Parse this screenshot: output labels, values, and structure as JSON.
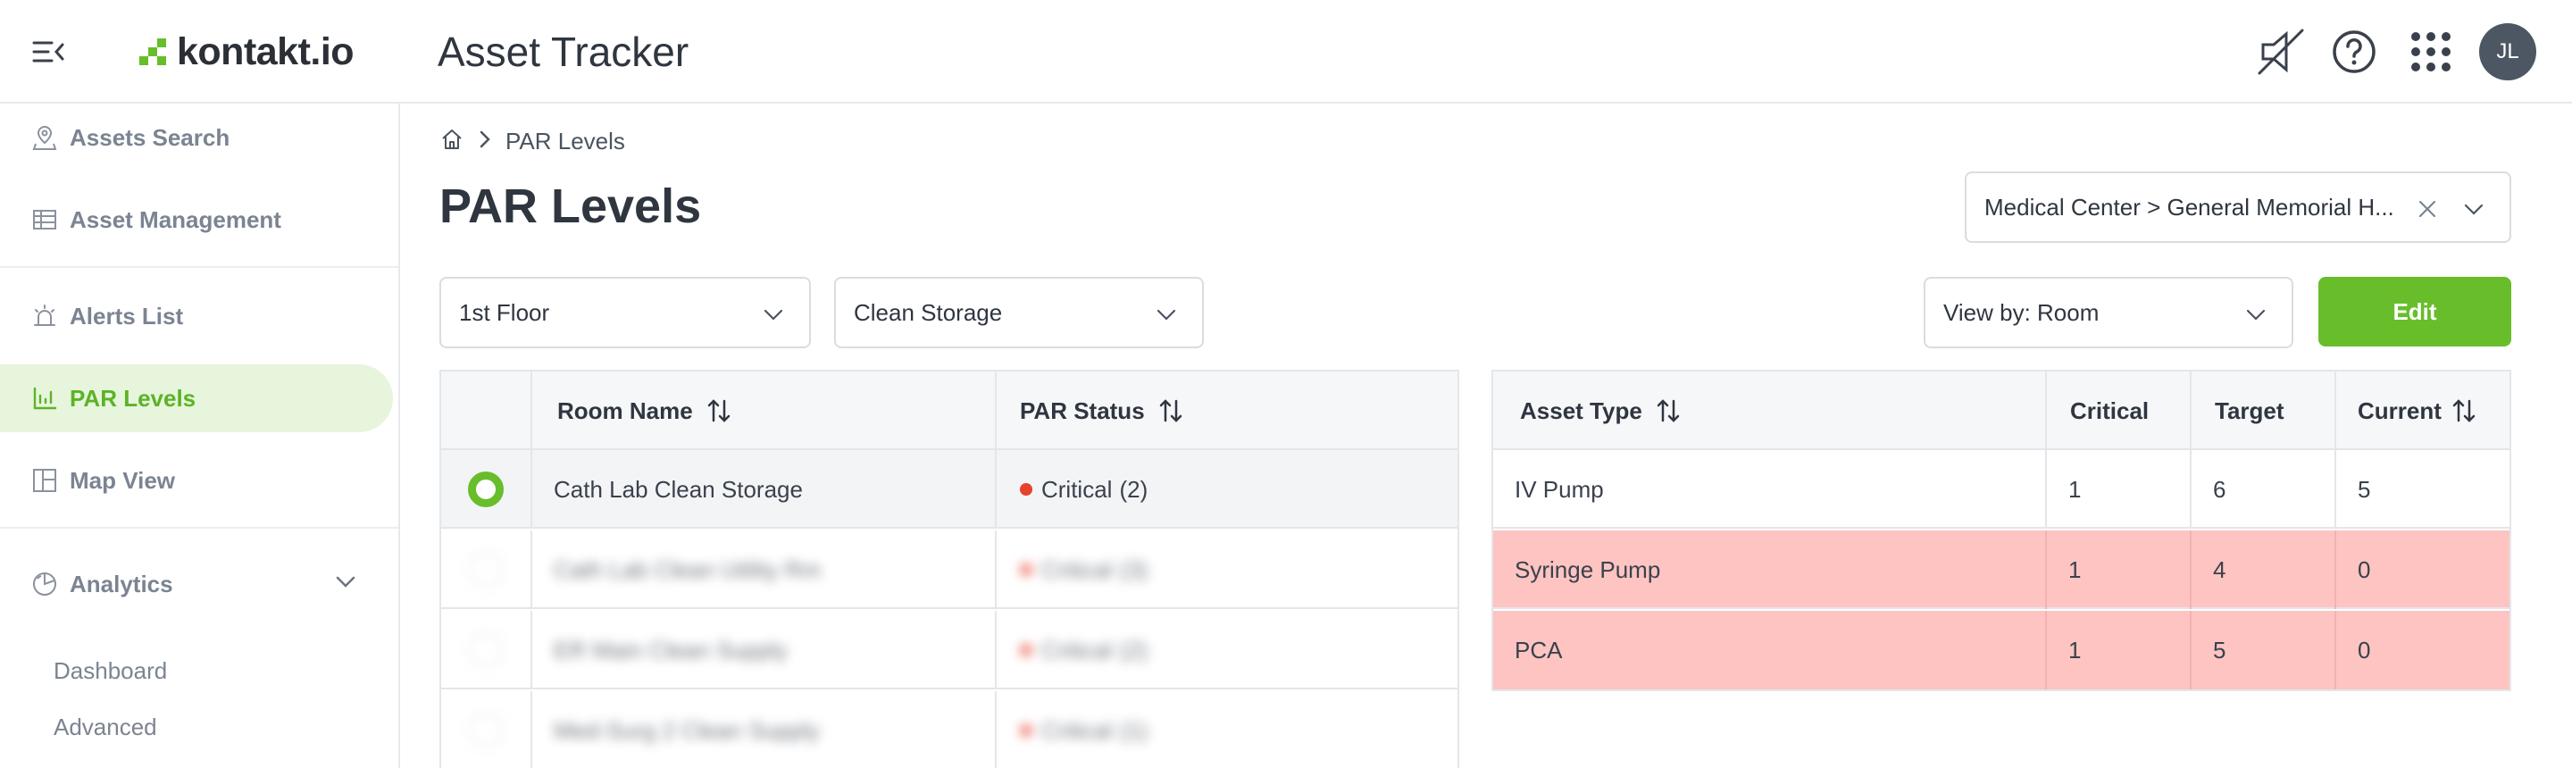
{
  "header": {
    "logo_text": "kontakt.io",
    "app_title": "Asset Tracker",
    "user_initials": "JL",
    "brand_color": "#68bd2b"
  },
  "sidebar": {
    "items": [
      {
        "label": "Assets Search",
        "icon": "map-pin-icon"
      },
      {
        "label": "Asset Management",
        "icon": "table-icon"
      },
      {
        "label": "Alerts List",
        "icon": "alarm-icon"
      },
      {
        "label": "PAR Levels",
        "icon": "bar-chart-icon",
        "active": true
      },
      {
        "label": "Map View",
        "icon": "layout-icon"
      },
      {
        "label": "Analytics",
        "icon": "analytics-icon",
        "expanded": true
      }
    ],
    "sub_items": [
      {
        "label": "Dashboard"
      },
      {
        "label": "Advanced"
      }
    ]
  },
  "breadcrumb": {
    "current": "PAR Levels"
  },
  "page": {
    "title": "PAR Levels",
    "location_filter": "Medical Center > General Memorial H...",
    "floor_filter": "1st Floor",
    "room_filter": "Clean Storage",
    "view_by": "View by: Room",
    "edit_label": "Edit"
  },
  "rooms_table": {
    "headers": [
      "Room Name",
      "PAR Status"
    ],
    "rows": [
      {
        "room": "Cath Lab Clean Storage",
        "status": "Critical",
        "count": "(2)",
        "selected": true
      },
      {
        "room": "Cath Lab Clean Utility Rm",
        "status": "Critical",
        "count": "(3)"
      },
      {
        "room": "ER Main Clean Supply",
        "status": "Critical",
        "count": "(2)"
      },
      {
        "room": "Med-Surg 2 Clean Supply",
        "status": "Critical",
        "count": "(1)"
      }
    ]
  },
  "assets_table": {
    "headers": [
      "Asset Type",
      "Critical",
      "Target",
      "Current"
    ],
    "rows": [
      {
        "type": "IV Pump",
        "critical": "1",
        "target": "6",
        "current": "5",
        "is_critical": false
      },
      {
        "type": "Syringe Pump",
        "critical": "1",
        "target": "4",
        "current": "0",
        "is_critical": true
      },
      {
        "type": "PCA",
        "critical": "1",
        "target": "5",
        "current": "0",
        "is_critical": true
      }
    ]
  }
}
